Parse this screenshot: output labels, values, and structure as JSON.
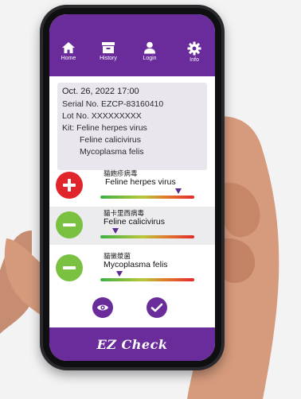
{
  "nav": [
    {
      "label": "Home",
      "icon": "home-icon"
    },
    {
      "label": "History",
      "icon": "archive-icon"
    },
    {
      "label": "Login",
      "icon": "user-icon"
    },
    {
      "label": "Info",
      "icon": "gear-icon"
    }
  ],
  "info": {
    "date": "Oct. 26, 2022 17:00",
    "serial": "Serial No. EZCP-83160410",
    "lot": "Lot No. XXXXXXXXX",
    "kit_label": "Kit: Feline herpes virus",
    "kit_item_2": "Feline calicivirus",
    "kit_item_3": "Mycoplasma felis"
  },
  "results": [
    {
      "name_zh": "貓皰疹病毒",
      "name_en": "Feline herpes virus",
      "status": "positive",
      "level": 0.83
    },
    {
      "name_zh": "貓卡里西病毒",
      "name_en": "Feline calicivirus",
      "status": "negative",
      "level": 0.16
    },
    {
      "name_zh": "貓黴漿菌",
      "name_en": "Mycoplasma felis",
      "status": "negative",
      "level": 0.2
    }
  ],
  "colors": {
    "brand_purple": "#6a2c9b",
    "positive_red": "#e0262b",
    "negative_green": "#7ac142"
  },
  "actions": [
    {
      "icon": "eye-icon"
    },
    {
      "icon": "check-icon"
    }
  ],
  "footer": {
    "brand": "EZ Check"
  }
}
